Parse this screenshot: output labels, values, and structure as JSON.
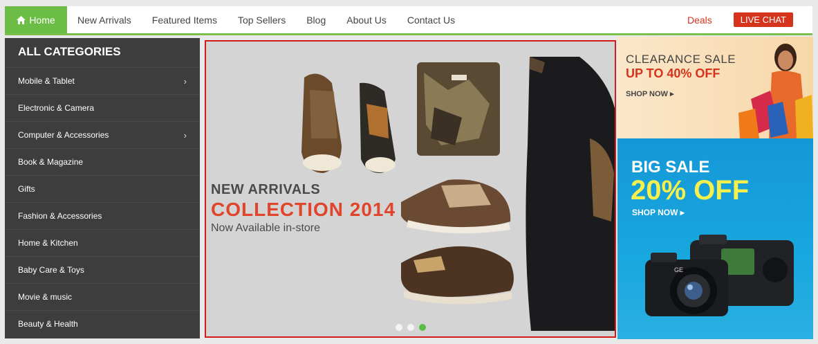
{
  "nav": {
    "home": "Home",
    "links": [
      "New Arrivals",
      "Featured Items",
      "Top Sellers",
      "Blog",
      "About Us",
      "Contact Us"
    ],
    "deals": "Deals",
    "live_chat": "LIVE CHAT",
    "icons": {
      "home": "home-icon"
    }
  },
  "sidebar": {
    "title": "ALL CATEGORIES",
    "items": [
      {
        "label": "Mobile & Tablet",
        "has_sub": true
      },
      {
        "label": "Electronic & Camera",
        "has_sub": false
      },
      {
        "label": "Computer & Accessories",
        "has_sub": true
      },
      {
        "label": "Book & Magazine",
        "has_sub": false
      },
      {
        "label": "Gifts",
        "has_sub": false
      },
      {
        "label": "Fashion & Accessories",
        "has_sub": false
      },
      {
        "label": "Home & Kitchen",
        "has_sub": false
      },
      {
        "label": "Baby Care & Toys",
        "has_sub": false
      },
      {
        "label": "Movie & music",
        "has_sub": false
      },
      {
        "label": "Beauty & Health",
        "has_sub": false
      }
    ]
  },
  "slider": {
    "line1": "NEW ARRIVALS",
    "line2": "COLLECTION 2014",
    "line3": "Now Available in-store",
    "dots": 3,
    "active_dot": 2
  },
  "banner1": {
    "line1": "CLEARANCE SALE",
    "line2": "UP TO 40% OFF",
    "cta": "SHOP NOW"
  },
  "banner2": {
    "line1": "BIG SALE",
    "line2": "20% OFF",
    "cta": "SHOP NOW"
  },
  "colors": {
    "accent_green": "#6bbd45",
    "accent_red": "#d6331c",
    "sidebar_bg": "#3d3d3d",
    "banner_blue": "#1a9fdb"
  }
}
